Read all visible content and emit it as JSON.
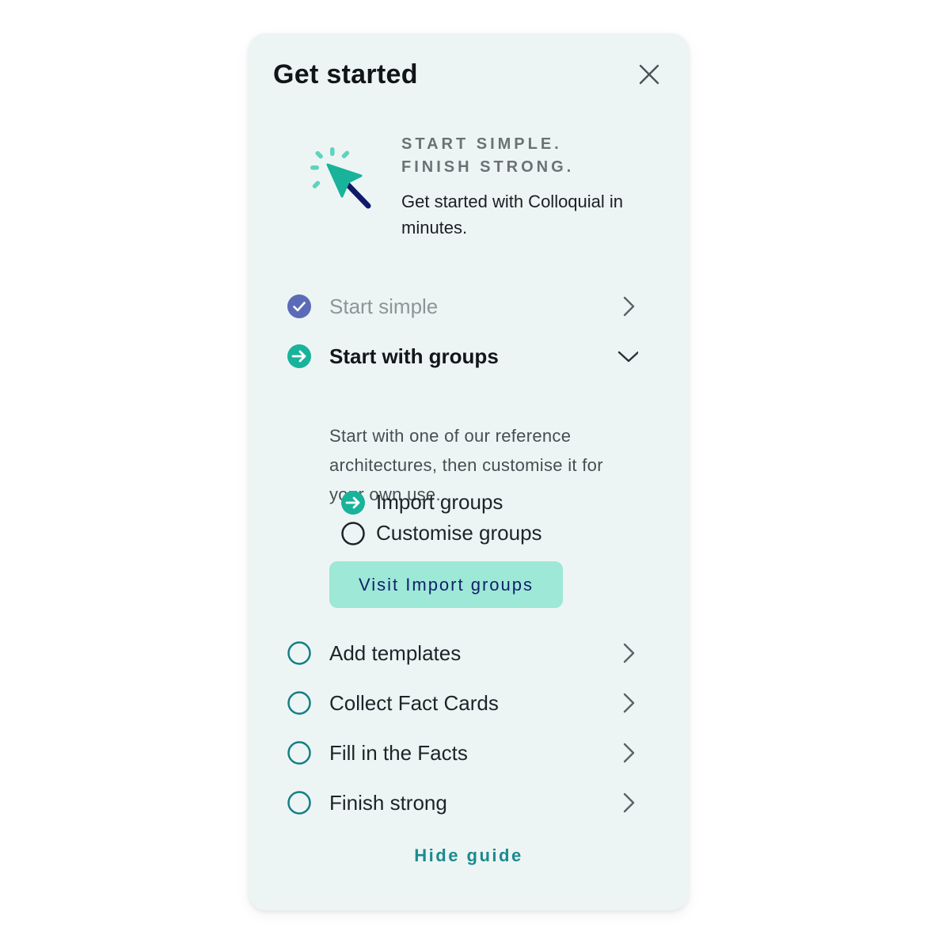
{
  "panel": {
    "title": "Get started",
    "close_icon": "close-icon",
    "hero": {
      "icon": "cursor-click-icon",
      "tagline_line1": "START SIMPLE.",
      "tagline_line2": "FINISH STRONG.",
      "intro": "Get started with Colloquial in minutes."
    },
    "steps": [
      {
        "label": "Start simple",
        "status": "completed",
        "icon": "check-circle-icon",
        "action_icon": "chevron-right-icon"
      },
      {
        "label": "Start with groups",
        "status": "in-progress",
        "icon": "arrow-circle-icon",
        "action_icon": "chevron-down-icon",
        "description": "Start with one of our reference architectures, then customise it for your own use.",
        "substeps": [
          {
            "label": "Import groups",
            "status": "in-progress",
            "icon": "arrow-circle-icon"
          },
          {
            "label": "Customise groups",
            "status": "not-started",
            "icon": "empty-circle-icon"
          }
        ],
        "cta_label": "Visit Import groups"
      },
      {
        "label": "Add templates",
        "status": "not-started",
        "icon": "empty-circle-icon",
        "action_icon": "chevron-right-icon"
      },
      {
        "label": "Collect Fact Cards",
        "status": "not-started",
        "icon": "empty-circle-icon",
        "action_icon": "chevron-right-icon"
      },
      {
        "label": "Fill in the Facts",
        "status": "not-started",
        "icon": "empty-circle-icon",
        "action_icon": "chevron-right-icon"
      },
      {
        "label": "Finish strong",
        "status": "not-started",
        "icon": "empty-circle-icon",
        "action_icon": "chevron-right-icon"
      }
    ],
    "hide_label": "Hide guide"
  },
  "colors": {
    "panel_bg": "#edf5f4",
    "completed": "#5b6bb7",
    "active": "#18b39a",
    "pending_ring": "#147f86",
    "cta_bg": "#9de8d7",
    "cta_text": "#12206b",
    "link": "#1b8a8f",
    "cursor_arrow": "#18b39a",
    "cursor_handle": "#0f1a6b"
  }
}
